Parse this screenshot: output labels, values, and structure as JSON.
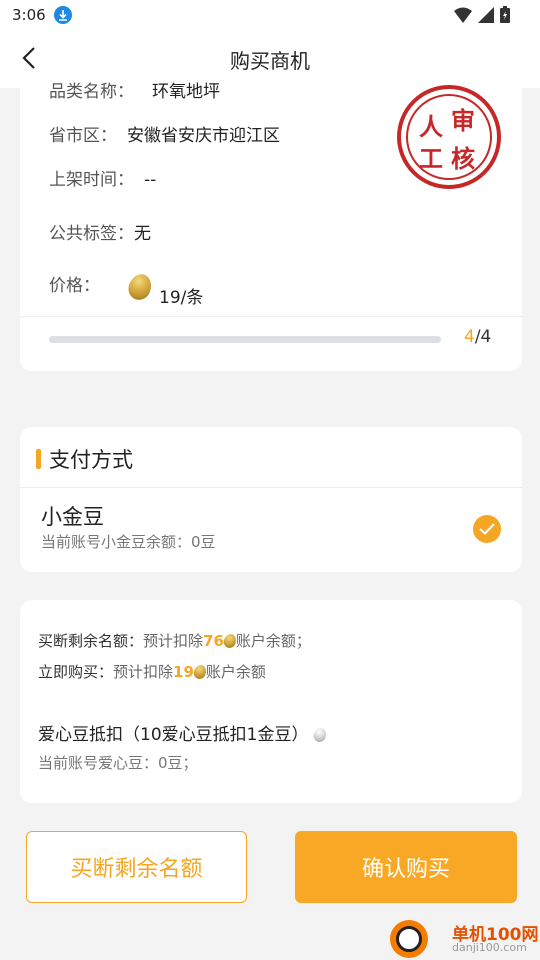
{
  "status_bar": {
    "time": "3:06"
  },
  "nav": {
    "title": "购买商机"
  },
  "info": {
    "category_label": "品类名称：",
    "category_value": "环氧地坪",
    "region_label": "省市区：",
    "region_value": "安徽省安庆市迎江区",
    "listed_label": "上架时间：",
    "listed_value": "--",
    "tags_label": "公共标签：",
    "tags_value": "无",
    "price_label": "价格：",
    "price_value": "19/条",
    "stamp_chars": [
      "人",
      "审",
      "工",
      "核"
    ],
    "progress_current": "4",
    "progress_total": "/4",
    "progress_fraction": 1.0
  },
  "payment": {
    "section_title": "支付方式",
    "method_name": "小金豆",
    "method_balance": "当前账号小金豆余额：0豆"
  },
  "deduction": {
    "buyout_label": "买断剩余名额：",
    "buyout_pre": "预计扣除",
    "buyout_amount": "76",
    "buyout_post": "账户余额；",
    "buy_now_label": "立即购买：",
    "buy_now_pre": "预计扣除",
    "buy_now_amount": "19",
    "buy_now_post": "账户余额",
    "love_title": "爱心豆抵扣（10爱心豆抵扣1金豆）",
    "love_balance": "当前账号爱心豆：0豆；"
  },
  "buttons": {
    "buyout": "买断剩余名额",
    "confirm": "确认购买"
  },
  "watermark": {
    "name": "单机100网",
    "url": "danji100.com"
  },
  "colors": {
    "accent": "#f5a623",
    "stamp_red": "#c62828"
  }
}
